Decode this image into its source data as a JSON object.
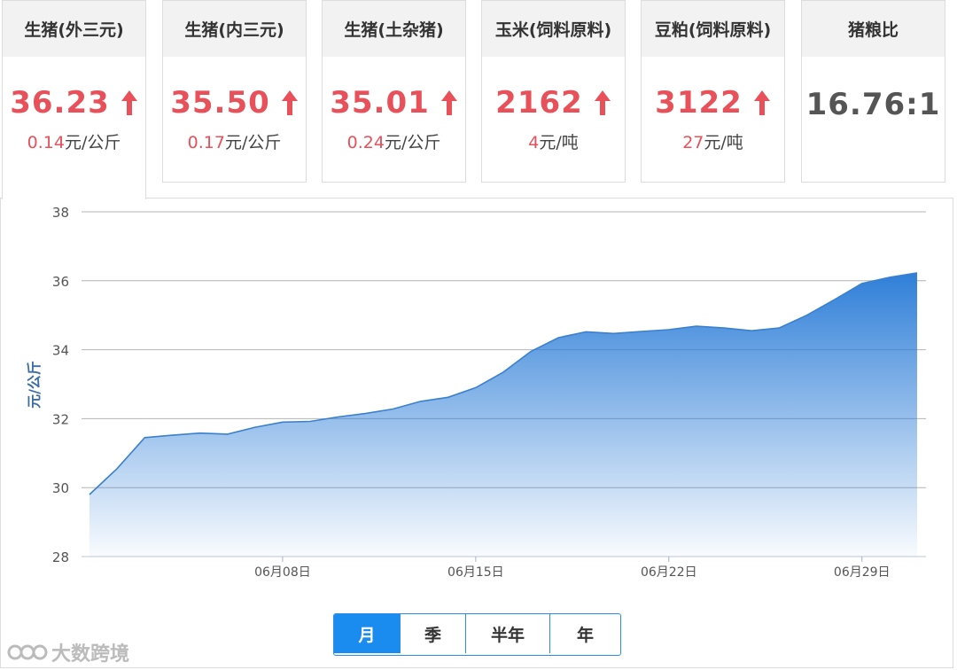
{
  "cards": [
    {
      "title": "生猪(外三元)",
      "price": "36.23",
      "trend": "up",
      "change_value": "0.14",
      "change_unit": "元/公斤"
    },
    {
      "title": "生猪(内三元)",
      "price": "35.50",
      "trend": "up",
      "change_value": "0.17",
      "change_unit": "元/公斤"
    },
    {
      "title": "生猪(土杂猪)",
      "price": "35.01",
      "trend": "up",
      "change_value": "0.24",
      "change_unit": "元/公斤"
    },
    {
      "title": "玉米(饲料原料)",
      "price": "2162",
      "trend": "up",
      "change_value": "4",
      "change_unit": "元/吨"
    },
    {
      "title": "豆粕(饲料原料)",
      "price": "3122",
      "trend": "up",
      "change_value": "27",
      "change_unit": "元/吨"
    },
    {
      "title": "猪粮比",
      "price": "16.76:1",
      "trend": "none",
      "change_value": "",
      "change_unit": ""
    }
  ],
  "colors": {
    "up": "#e8505a",
    "neutral": "#555555",
    "accent": "#1a8cf0",
    "area_top": "#2f7fd8",
    "line": "#3a80cf"
  },
  "range_tabs": [
    {
      "label": "月",
      "active": true
    },
    {
      "label": "季",
      "active": false
    },
    {
      "label": "半年",
      "active": false
    },
    {
      "label": "年",
      "active": false
    }
  ],
  "watermark": "大数跨境",
  "chart_data": {
    "type": "area",
    "ylabel": "元/公斤",
    "xlabel": "",
    "ylim": [
      28,
      38
    ],
    "yticks": [
      28,
      30,
      32,
      34,
      36,
      38
    ],
    "xticks": [
      "06月08日",
      "06月15日",
      "06月22日",
      "06月29日"
    ],
    "grid": true,
    "x": [
      "06月01日",
      "06月02日",
      "06月03日",
      "06月04日",
      "06月05日",
      "06月06日",
      "06月07日",
      "06月08日",
      "06月09日",
      "06月10日",
      "06月11日",
      "06月12日",
      "06月13日",
      "06月14日",
      "06月15日",
      "06月16日",
      "06月17日",
      "06月18日",
      "06月19日",
      "06月20日",
      "06月21日",
      "06月22日",
      "06月23日",
      "06月24日",
      "06月25日",
      "06月26日",
      "06月27日",
      "06月28日",
      "06月29日",
      "06月30日",
      "07月01日"
    ],
    "series": [
      {
        "values": [
          29.8,
          30.55,
          31.45,
          31.52,
          31.58,
          31.55,
          31.75,
          31.9,
          31.92,
          32.05,
          32.15,
          32.28,
          32.5,
          32.62,
          32.9,
          33.35,
          33.95,
          34.35,
          34.52,
          34.47,
          34.53,
          34.58,
          34.68,
          34.63,
          34.55,
          34.63,
          35.0,
          35.45,
          35.92,
          36.1,
          36.23
        ]
      }
    ]
  }
}
